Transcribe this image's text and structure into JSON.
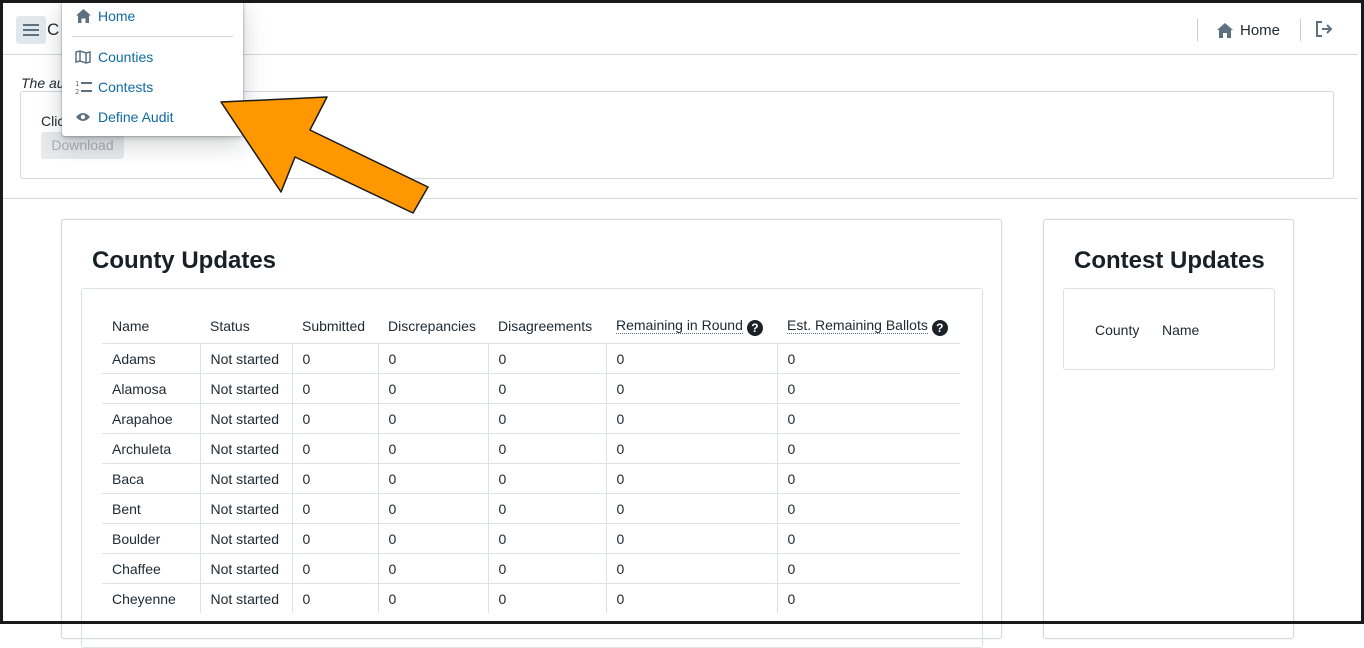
{
  "navbar": {
    "title": "C",
    "home_label": "Home",
    "icons": {
      "menu": "hamburger-icon",
      "home": "home-icon",
      "logout": "log-out-icon"
    }
  },
  "dropdown": {
    "items": [
      {
        "label": "Home",
        "icon": "home-icon"
      },
      {
        "label": "Counties",
        "icon": "map-icon"
      },
      {
        "label": "Contests",
        "icon": "numbered-list-icon"
      },
      {
        "label": "Define Audit",
        "icon": "eye-icon"
      }
    ]
  },
  "audit": {
    "status_text": "The au",
    "download_prompt": "Clic",
    "download_label": "Download"
  },
  "county_updates": {
    "title": "County Updates",
    "columns": [
      "Name",
      "Status",
      "Submitted",
      "Discrepancies",
      "Disagreements",
      "Remaining in Round",
      "Est. Remaining Ballots"
    ],
    "rows": [
      [
        "Adams",
        "Not started",
        "0",
        "0",
        "0",
        "0",
        "0"
      ],
      [
        "Alamosa",
        "Not started",
        "0",
        "0",
        "0",
        "0",
        "0"
      ],
      [
        "Arapahoe",
        "Not started",
        "0",
        "0",
        "0",
        "0",
        "0"
      ],
      [
        "Archuleta",
        "Not started",
        "0",
        "0",
        "0",
        "0",
        "0"
      ],
      [
        "Baca",
        "Not started",
        "0",
        "0",
        "0",
        "0",
        "0"
      ],
      [
        "Bent",
        "Not started",
        "0",
        "0",
        "0",
        "0",
        "0"
      ],
      [
        "Boulder",
        "Not started",
        "0",
        "0",
        "0",
        "0",
        "0"
      ],
      [
        "Chaffee",
        "Not started",
        "0",
        "0",
        "0",
        "0",
        "0"
      ],
      [
        "Cheyenne",
        "Not started",
        "0",
        "0",
        "0",
        "0",
        "0"
      ]
    ]
  },
  "contest_updates": {
    "title": "Contest Updates",
    "columns": [
      "County",
      "Name"
    ]
  },
  "colors": {
    "link": "#106ba3",
    "arrow_fill": "#ff9800",
    "text": "#202b33"
  }
}
